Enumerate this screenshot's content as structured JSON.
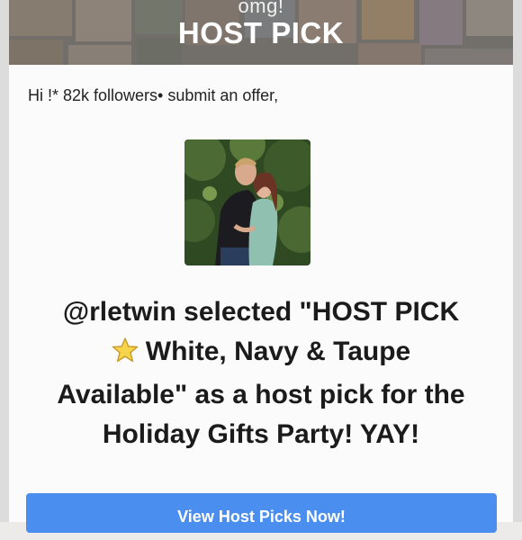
{
  "banner": {
    "eyebrow": "omg!",
    "title": "HOST PICK"
  },
  "greeting": "Hi !* 82k followers• submit an offer,",
  "selection": {
    "line1": "@rletwin selected \"HOST PICK",
    "line2": "White, Navy & Taupe",
    "line3": "Available\" as a host pick for the",
    "line4": "Holiday Gifts Party! YAY!",
    "star_icon": "star-icon"
  },
  "cta": {
    "label": "View Host Picks Now!"
  },
  "colors": {
    "accent": "#4a8ff0",
    "text": "#1b1b1b",
    "background": "#fbfbfb"
  }
}
